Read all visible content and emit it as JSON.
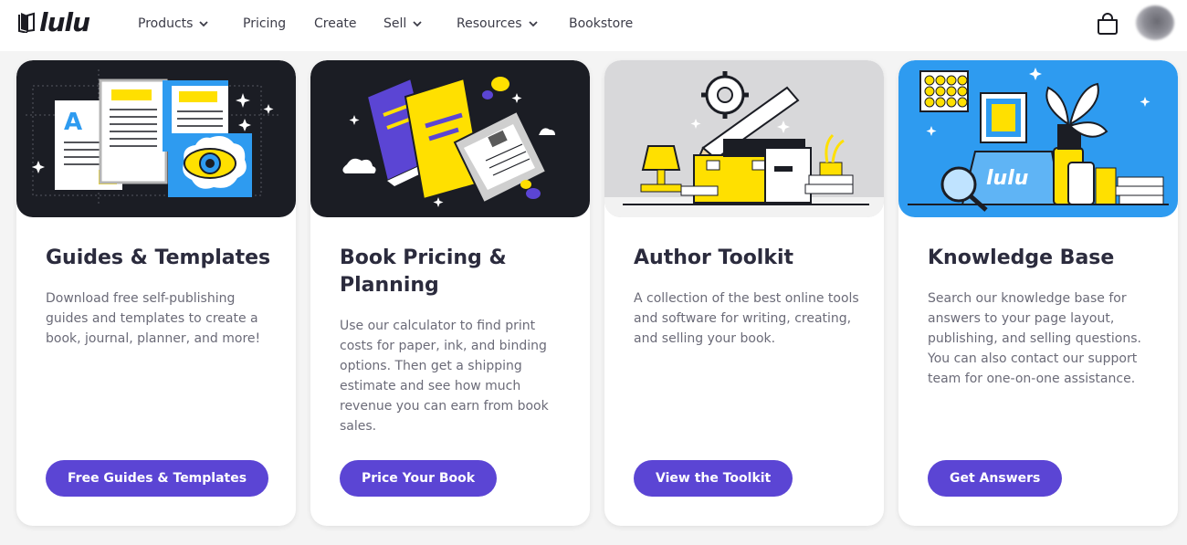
{
  "brand": {
    "name": "lulu"
  },
  "nav": [
    {
      "label": "Products",
      "dropdown": true
    },
    {
      "label": "Pricing",
      "dropdown": false
    },
    {
      "label": "Create",
      "dropdown": false
    },
    {
      "label": "Sell",
      "dropdown": true
    },
    {
      "label": "Resources",
      "dropdown": true
    },
    {
      "label": "Bookstore",
      "dropdown": false
    }
  ],
  "header_icons": {
    "cart": "shopping-bag-icon",
    "avatar": "user-avatar"
  },
  "colors": {
    "accent": "#5b45d4",
    "yellow": "#ffe000",
    "dark": "#1b1d24",
    "blue": "#2e9bf0"
  },
  "cards": [
    {
      "title": "Guides & Templates",
      "description": "Download free self-publishing guides and templates to create a book, journal, planner, and more!",
      "button": "Free Guides & Templates"
    },
    {
      "title": "Book Pricing & Planning",
      "description": "Use our calculator to find print costs for paper, ink, and binding options. Then get a shipping estimate and see how much revenue you can earn from book sales.",
      "button": "Price Your Book"
    },
    {
      "title": "Author Toolkit",
      "description": "A collection of the best online tools and software for writing, creating, and selling your book.",
      "button": "View the Toolkit"
    },
    {
      "title": "Knowledge Base",
      "description": "Search our knowledge base for answers to your page layout, publishing, and selling questions. You can also contact our support team for one-on-one assistance.",
      "button": "Get Answers"
    }
  ]
}
